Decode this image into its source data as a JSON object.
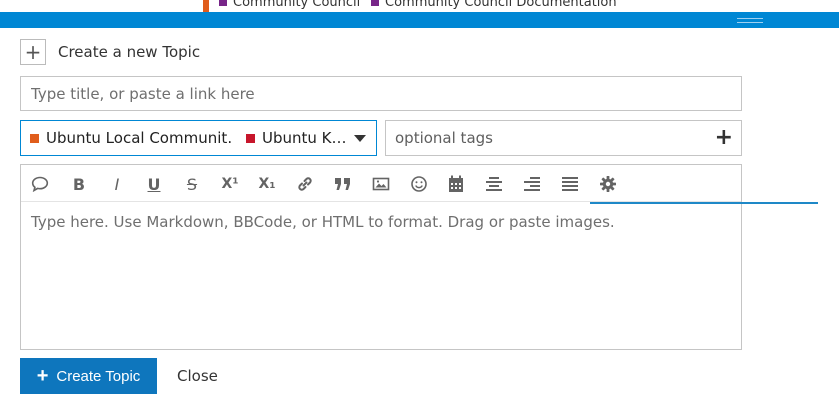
{
  "background": {
    "categories": [
      {
        "label": "Community Council",
        "color": "#772588"
      },
      {
        "label": "Community Council Documentation",
        "color": "#772588"
      }
    ]
  },
  "composer": {
    "action_title": "Create a new Topic",
    "title_placeholder": "Type title, or paste a link here",
    "category": {
      "parent": "Ubuntu Local Communit…",
      "parent_color": "#e05d1c",
      "child": "Ubuntu K…",
      "child_color": "#c7162b"
    },
    "tags_placeholder": "optional tags",
    "editor_placeholder": "Type here. Use Markdown, BBCode, or HTML to format. Drag or paste images.",
    "toolbar": {
      "bold": "B",
      "italic": "I",
      "underline": "U",
      "strike": "S",
      "superscript": "X¹",
      "subscript": "X₁"
    },
    "create_button_label": "Create Topic",
    "close_label": "Close"
  },
  "colors": {
    "brand": "#0087d4",
    "button": "#0e76bd"
  }
}
